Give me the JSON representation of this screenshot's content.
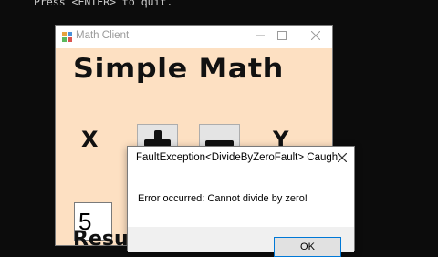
{
  "console": {
    "text": "Press <ENTER> to quit."
  },
  "window": {
    "title": "Math Client",
    "heading": "Simple Math",
    "x_label": "X",
    "y_label": "Y",
    "x_value": "5",
    "result_label": "Result",
    "plus_icon": "plus-icon",
    "minus_icon": "minus-icon"
  },
  "dialog": {
    "title": "FaultException<DivideByZeroFault> Caught",
    "message": "Error occurred: Cannot divide by zero!",
    "ok_label": "OK"
  },
  "colors": {
    "client_bg": "#fde0c2",
    "accent": "#0078d7"
  }
}
